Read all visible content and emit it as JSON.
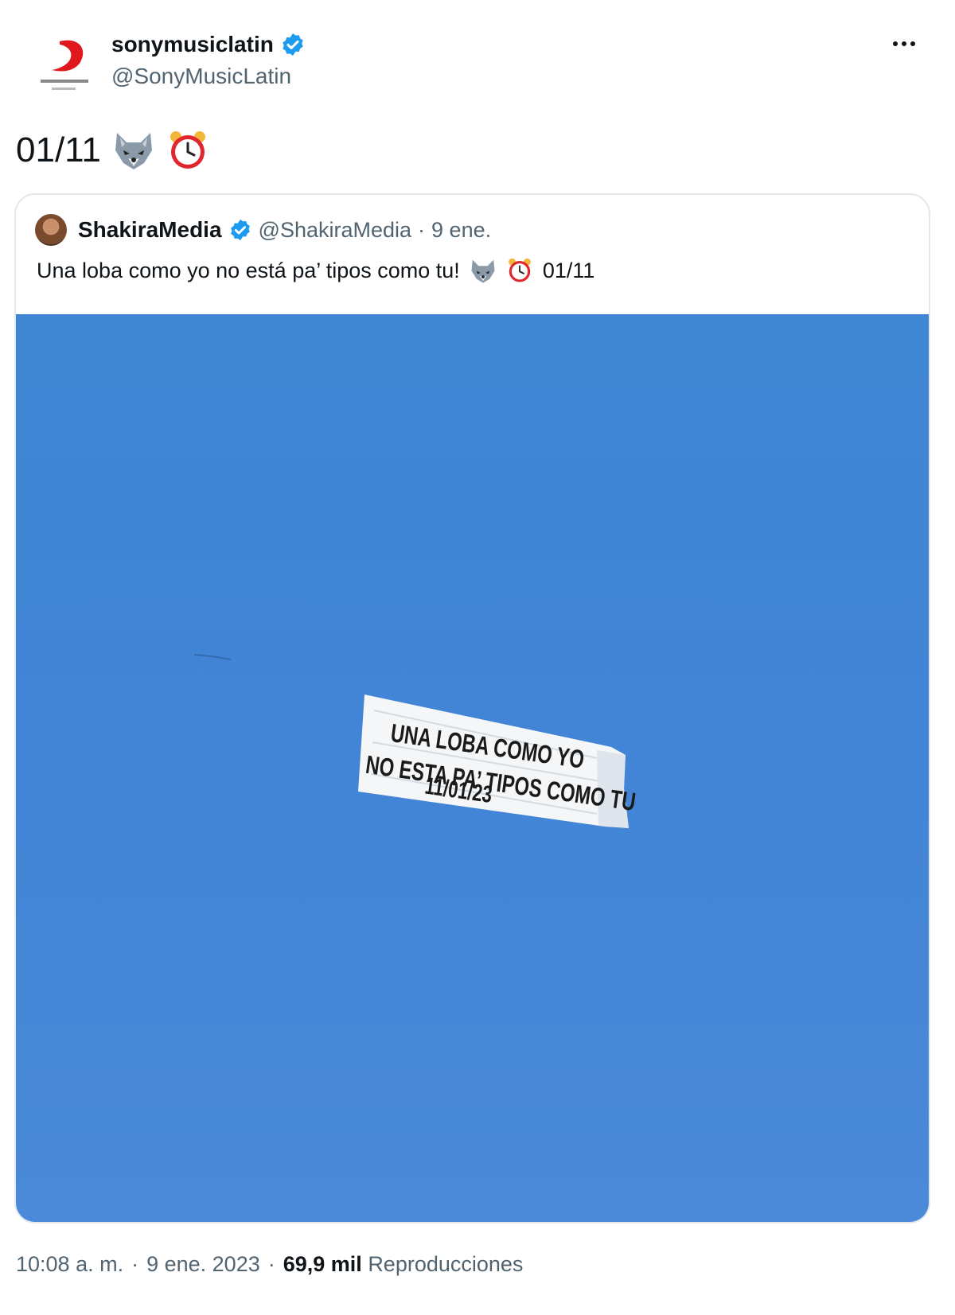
{
  "author": {
    "display_name": "sonymusiclatin",
    "handle": "@SonyMusicLatin"
  },
  "tweet": {
    "text": "01/11",
    "emoji": [
      "wolf-icon",
      "alarm-clock-icon"
    ]
  },
  "quoted": {
    "display_name": "ShakiraMedia",
    "handle": "@ShakiraMedia",
    "separator": "·",
    "date": "9 ene.",
    "text": "Una loba como yo no está pa’ tipos como tu!",
    "text_suffix": "01/11",
    "banner_lines": [
      "UNA LOBA COMO YO",
      "NO ESTA PA’ TIPOS COMO TU",
      "11/01/23"
    ]
  },
  "meta": {
    "time": "10:08 a. m.",
    "sep1": "·",
    "date": "9 ene. 2023",
    "sep2": "·",
    "views": "69,9 mil",
    "views_label": "Reproducciones"
  },
  "colors": {
    "verified": "#1d9bf0",
    "sky": "#4286d6",
    "sony_red": "#e0181e"
  }
}
